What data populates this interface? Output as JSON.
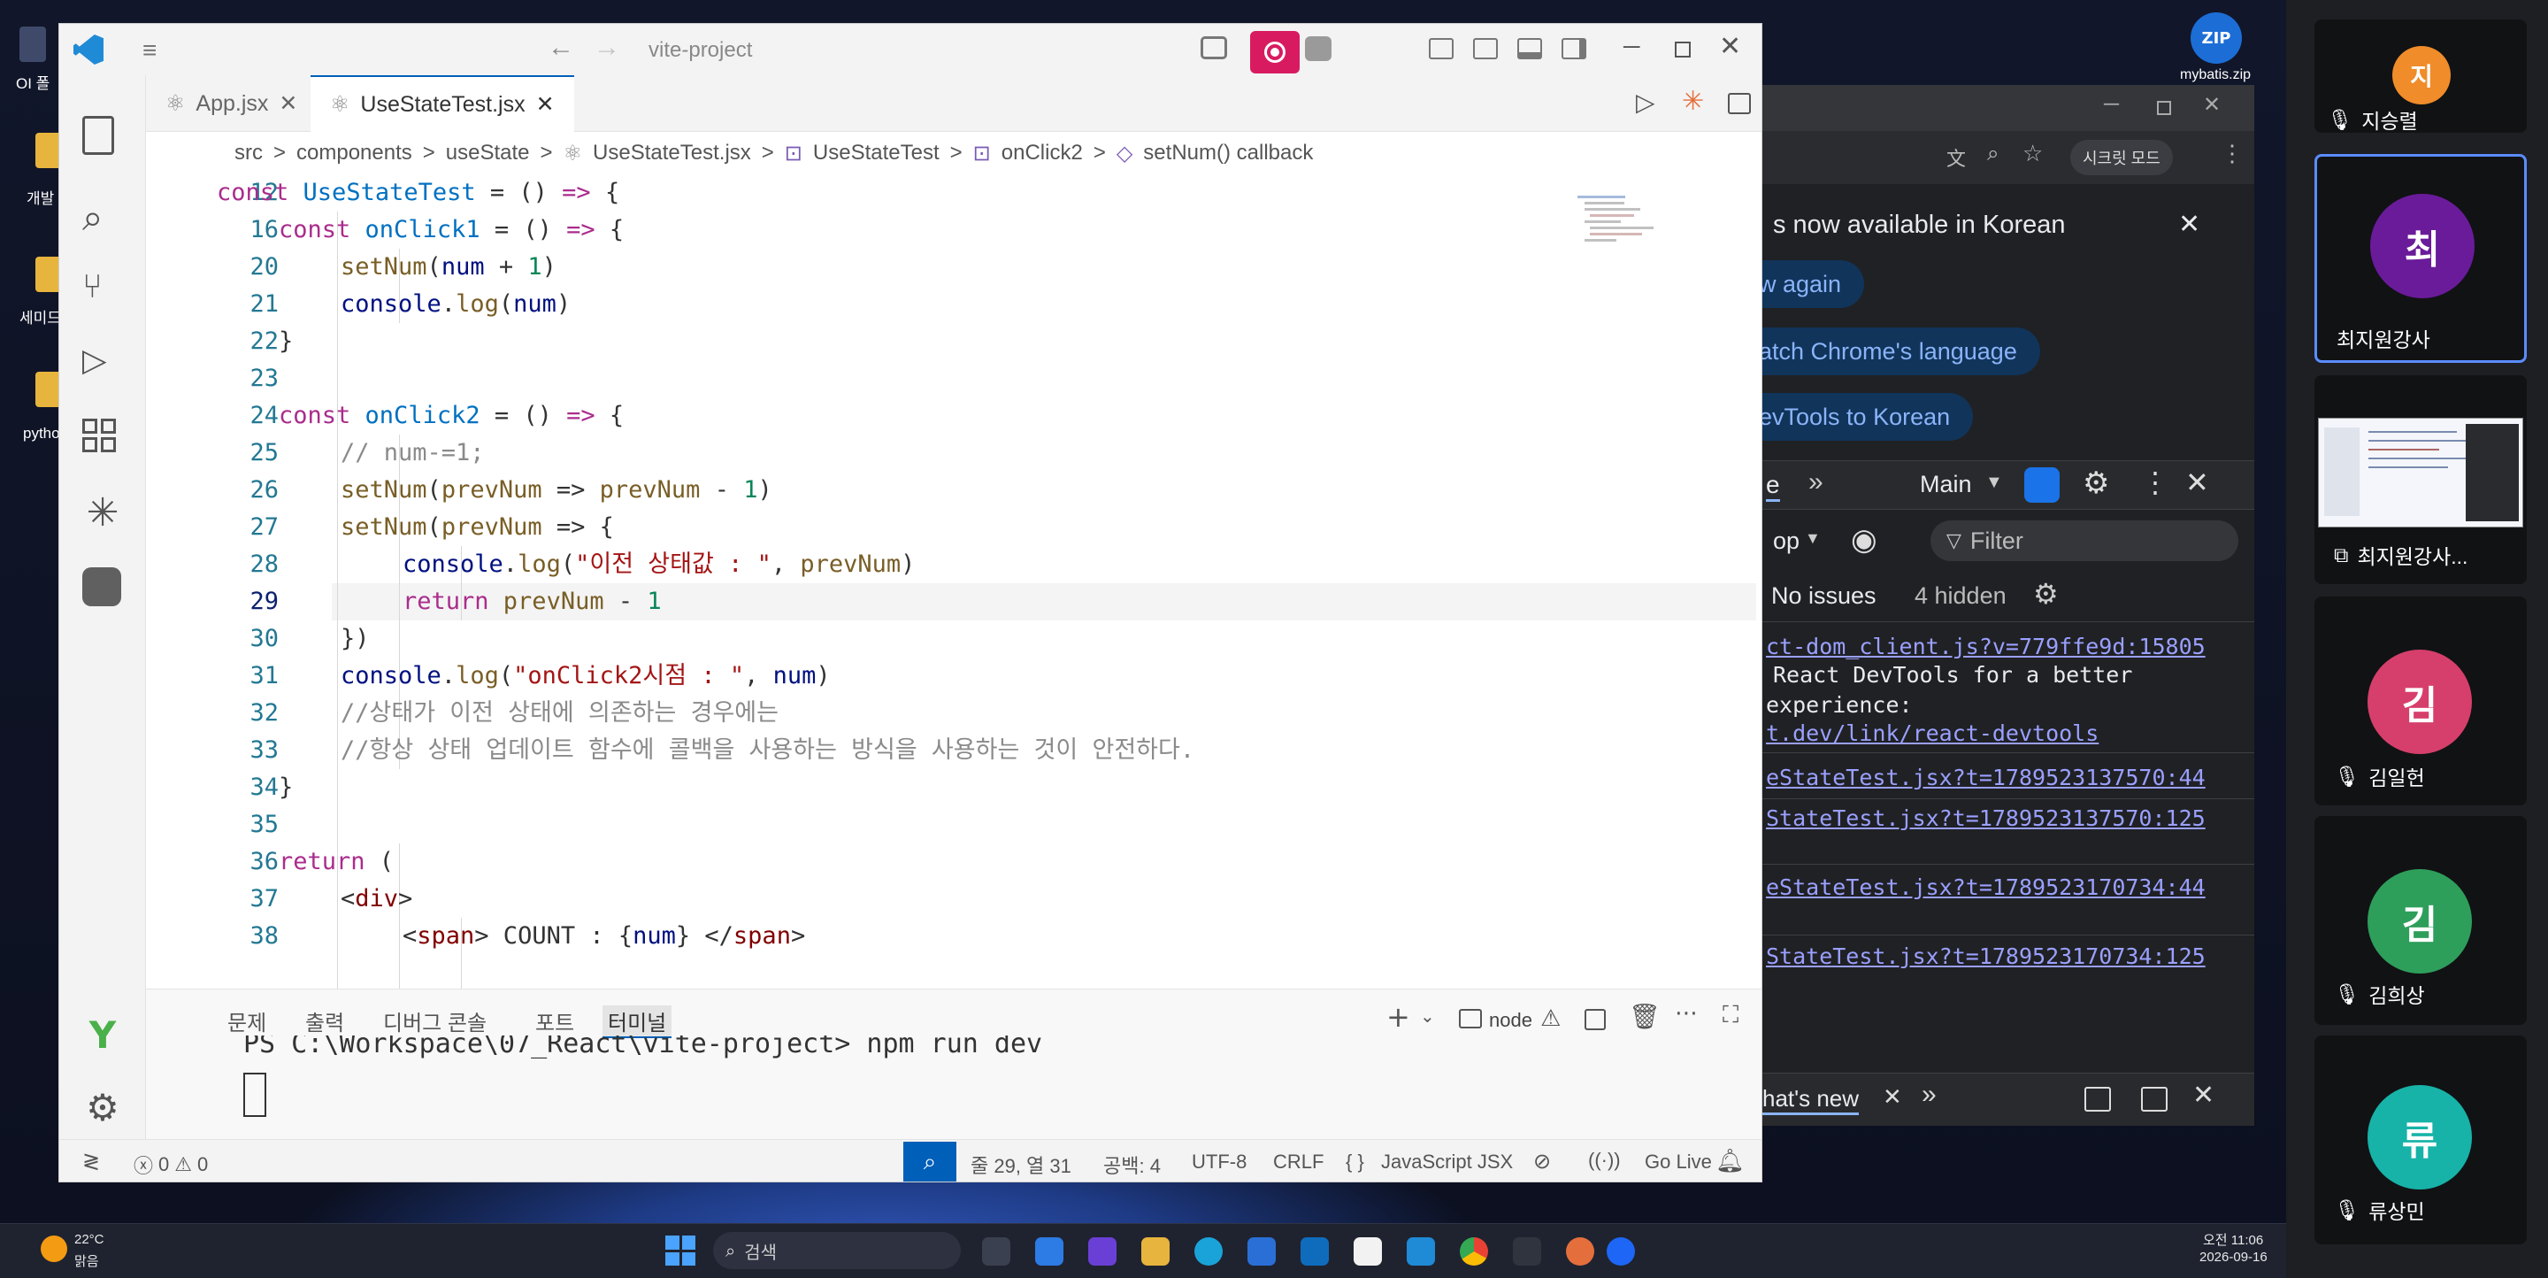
{
  "desktop": {
    "icons": [
      "OI 폴",
      "개발",
      "세미드",
      "pytho"
    ],
    "zip_label": "mybatis.zip"
  },
  "vscode": {
    "title": "vite-project",
    "tabs": [
      {
        "label": "App.jsx",
        "active": false
      },
      {
        "label": "UseStateTest.jsx",
        "active": true
      }
    ],
    "breadcrumb": [
      "src",
      "components",
      "useState",
      "UseStateTest.jsx",
      "UseStateTest",
      "onClick2",
      "setNum() callback"
    ],
    "panel_tabs": [
      "문제",
      "출력",
      "디버그 콘솔",
      "포트",
      "터미널"
    ],
    "terminal_type": "node",
    "terminal_line": "PS C:\\Workspace\\07_React\\vite-project> npm run dev",
    "status": {
      "errors": "0",
      "warnings": "0",
      "position": "줄 29, 열 31",
      "spaces": "공백: 4",
      "encoding": "UTF-8",
      "eol": "CRLF",
      "language": "JavaScript JSX",
      "golive": "Go Live"
    },
    "code_lines": [
      {
        "n": "12",
        "i": 0,
        "t": [
          [
            "kw",
            "const "
          ],
          [
            "fnb",
            "UseStateTest"
          ],
          [
            "pun",
            " = () "
          ],
          [
            "kw",
            "=>"
          ],
          [
            "pun",
            " {"
          ]
        ]
      },
      {
        "n": "16",
        "i": 1,
        "t": [
          [
            "kw",
            "const "
          ],
          [
            "fnb",
            "onClick1"
          ],
          [
            "pun",
            " = () "
          ],
          [
            "kw",
            "=>"
          ],
          [
            "pun",
            " {"
          ]
        ]
      },
      {
        "n": "20",
        "i": 2,
        "t": [
          [
            "fn",
            "setNum"
          ],
          [
            "pun",
            "("
          ],
          [
            "var",
            "num"
          ],
          [
            "pun",
            " + "
          ],
          [
            "num",
            "1"
          ],
          [
            "pun",
            ")"
          ]
        ]
      },
      {
        "n": "21",
        "i": 2,
        "t": [
          [
            "var",
            "console"
          ],
          [
            "pun",
            "."
          ],
          [
            "fn",
            "log"
          ],
          [
            "pun",
            "("
          ],
          [
            "var",
            "num"
          ],
          [
            "pun",
            ")"
          ]
        ]
      },
      {
        "n": "22",
        "i": 1,
        "t": [
          [
            "pun",
            "}"
          ]
        ]
      },
      {
        "n": "23",
        "i": 0,
        "t": []
      },
      {
        "n": "24",
        "i": 1,
        "t": [
          [
            "kw",
            "const "
          ],
          [
            "fnb",
            "onClick2"
          ],
          [
            "pun",
            " = () "
          ],
          [
            "kw",
            "=>"
          ],
          [
            "pun",
            " {"
          ]
        ]
      },
      {
        "n": "25",
        "i": 2,
        "t": [
          [
            "cmt",
            "// num-=1;"
          ]
        ]
      },
      {
        "n": "26",
        "i": 2,
        "t": [
          [
            "fn",
            "setNum"
          ],
          [
            "pun",
            "("
          ],
          [
            "prm",
            "prevNum"
          ],
          [
            "pun",
            " => "
          ],
          [
            "prm",
            "prevNum"
          ],
          [
            "pun",
            " - "
          ],
          [
            "num",
            "1"
          ],
          [
            "pun",
            ")"
          ]
        ]
      },
      {
        "n": "27",
        "i": 2,
        "t": [
          [
            "fn",
            "setNum"
          ],
          [
            "pun",
            "("
          ],
          [
            "prm",
            "prevNum"
          ],
          [
            "pun",
            " => {"
          ]
        ]
      },
      {
        "n": "28",
        "i": 3,
        "t": [
          [
            "var",
            "console"
          ],
          [
            "pun",
            "."
          ],
          [
            "fn",
            "log"
          ],
          [
            "pun",
            "("
          ],
          [
            "str",
            "\"이전 상태값 : \""
          ],
          [
            "pun",
            ", "
          ],
          [
            "prm",
            "prevNum"
          ],
          [
            "pun",
            ")"
          ]
        ]
      },
      {
        "n": "29",
        "i": 3,
        "t": [
          [
            "kw",
            "return "
          ],
          [
            "prm",
            "prevNum"
          ],
          [
            "pun",
            " - "
          ],
          [
            "num",
            "1"
          ]
        ]
      },
      {
        "n": "30",
        "i": 2,
        "t": [
          [
            "pun",
            "})"
          ]
        ]
      },
      {
        "n": "31",
        "i": 2,
        "t": [
          [
            "var",
            "console"
          ],
          [
            "pun",
            "."
          ],
          [
            "fn",
            "log"
          ],
          [
            "pun",
            "("
          ],
          [
            "str",
            "\"onClick2시점 : \""
          ],
          [
            "pun",
            ", "
          ],
          [
            "var",
            "num"
          ],
          [
            "pun",
            ")"
          ]
        ]
      },
      {
        "n": "32",
        "i": 2,
        "t": [
          [
            "cmt",
            "//상태가 이전 상태에 의존하는 경우에는"
          ]
        ]
      },
      {
        "n": "33",
        "i": 2,
        "t": [
          [
            "cmt",
            "//항상 상태 업데이트 함수에 콜백을 사용하는 방식을 사용하는 것이 안전하다."
          ]
        ]
      },
      {
        "n": "34",
        "i": 1,
        "t": [
          [
            "pun",
            "}"
          ]
        ]
      },
      {
        "n": "35",
        "i": 0,
        "t": []
      },
      {
        "n": "36",
        "i": 1,
        "t": [
          [
            "kw",
            "return "
          ],
          [
            "pun",
            "("
          ]
        ]
      },
      {
        "n": "37",
        "i": 2,
        "t": [
          [
            "pun",
            "<"
          ],
          [
            "tag",
            "div"
          ],
          [
            "pun",
            ">"
          ]
        ]
      },
      {
        "n": "38",
        "i": 3,
        "t": [
          [
            "pun",
            "<"
          ],
          [
            "tag",
            "span"
          ],
          [
            "pun",
            "> COUNT : {"
          ],
          [
            "var",
            "num"
          ],
          [
            "pun",
            "} </"
          ],
          [
            "tag",
            "span"
          ],
          [
            "pun",
            ">"
          ]
        ]
      }
    ]
  },
  "devtools": {
    "banner": "s now available in Korean",
    "btn_again": "w again",
    "btn_match": "atch Chrome's language",
    "btn_korean": "evTools to Korean",
    "toolbar_tab": "e",
    "main": "Main",
    "top_select": "op",
    "filter": "Filter",
    "no_issues": "No issues",
    "hidden": "4 hidden",
    "incognito": "시크릿 모드",
    "links": [
      "ct-dom_client.js?v=779ffe9d:15805",
      "eStateTest.jsx?t=1789523137570:44",
      "StateTest.jsx?t=1789523137570:125",
      "eStateTest.jsx?t=1789523170734:44",
      "StateTest.jsx?t=1789523170734:125"
    ],
    "msg1": "React DevTools for a better",
    "msg2": "experience:",
    "msg3": "t.dev/link/react-devtools",
    "whatsnew": "hat's new"
  },
  "participants": [
    {
      "initial": "지",
      "name": "지승렬",
      "color": "#f08c2a"
    },
    {
      "initial": "최",
      "name": "최지원강사",
      "color": "#6a1b9a"
    },
    {
      "initial": "",
      "name": "최지원강사...",
      "color": "#ffffff"
    },
    {
      "initial": "김",
      "name": "김일헌",
      "color": "#d63f6b"
    },
    {
      "initial": "김",
      "name": "김희상",
      "color": "#2e9e5b"
    },
    {
      "initial": "류",
      "name": "류상민",
      "color": "#17b3a8"
    }
  ],
  "tray": {
    "weather_temp": "22°C",
    "weather_desc": "맑음",
    "time": "오전 11:06",
    "date": "2026-09-16",
    "search": "검색"
  }
}
